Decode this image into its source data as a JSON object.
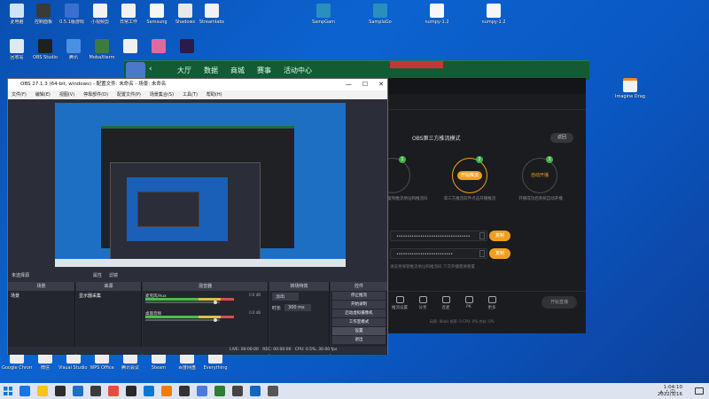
{
  "desktop_icons": [
    {
      "label": "此电脑",
      "color": "#cfe3f7"
    },
    {
      "label": "控制面板",
      "color": "#3a3a3a"
    },
    {
      "label": "0.5.1版游戏",
      "color": "#3a6fd0"
    },
    {
      "label": "小视频剪",
      "color": "#f2f2f2"
    },
    {
      "label": "日常工作",
      "color": "#f2f2f2"
    },
    {
      "label": "Samsung",
      "color": "#f7f7f7"
    },
    {
      "label": "Shadows",
      "color": "#e8e8e8"
    },
    {
      "label": "Streamlabs",
      "color": "#f2f2f2"
    },
    {
      "label": "SampGam",
      "color": "#2a8fbf"
    },
    {
      "label": "SamplaGo",
      "color": "#2a8fbf"
    },
    {
      "label": "numpy-1.2",
      "color": "#f6f6f6"
    },
    {
      "label": "numpy-1.2",
      "color": "#f6f6f6"
    }
  ],
  "desktop_icons_row2": [
    {
      "label": "回收站",
      "color": "#dfe8f2"
    },
    {
      "label": "OBS Studio",
      "color": "#202020"
    },
    {
      "label": "腾讯",
      "color": "#4a90e2"
    },
    {
      "label": "MobaXterm",
      "color": "#3d7a3d"
    },
    {
      "label": "",
      "color": "#f0f0f0"
    },
    {
      "label": "",
      "color": "#e06aa0"
    },
    {
      "label": "",
      "color": "#2b1b48"
    }
  ],
  "bottom_icons": [
    {
      "label": "Google Chrome"
    },
    {
      "label": "微信"
    },
    {
      "label": "Visual Studio Code"
    },
    {
      "label": "WPS Office"
    },
    {
      "label": "腾讯会议"
    },
    {
      "label": "Steam"
    },
    {
      "label": "百度网盘"
    },
    {
      "label": "Everything"
    }
  ],
  "right_file": {
    "label": "Imagine Dragons - ..."
  },
  "green_window": {
    "back": "‹",
    "nav": [
      "大厅",
      "数据",
      "商城",
      "赛事",
      "活动中心"
    ]
  },
  "obs_window": {
    "title": "OBS 27.1.3 (64-bit, windows) - 配置文件: 未命名 - 场景: 未命名",
    "window_controls": [
      "—",
      "☐",
      "✕"
    ],
    "menu": [
      "文件(F)",
      "编辑(E)",
      "视图(V)",
      "停靠部件(D)",
      "配置文件(P)",
      "场景集合(S)",
      "工具(T)",
      "帮助(H)"
    ],
    "no_source": "未选择源",
    "source_buttons": [
      "属性",
      "滤镜"
    ],
    "docks": {
      "scenes": {
        "header": "场景",
        "items": [
          "场景"
        ]
      },
      "sources": {
        "header": "来源",
        "items": [
          "显示器采集"
        ]
      },
      "mixer": {
        "header": "混音器",
        "channels": [
          {
            "name": "麦克风/Aux",
            "db": "0.0 dB"
          },
          {
            "name": "桌面音频",
            "db": "0.0 dB"
          }
        ]
      },
      "transitions": {
        "header": "转场特效",
        "type": "淡出",
        "duration_label": "时长",
        "duration": "300 ms"
      },
      "controls": {
        "header": "控件",
        "buttons": [
          "停止推流",
          "开始录制",
          "启动虚拟摄像机",
          "工作室模式",
          "设置",
          "退出"
        ]
      }
    },
    "status": {
      "live": "LIVE: 00:00:00",
      "rec": "REC: 00:00:00",
      "cpu": "CPU: 0.5%, 30.00 fps"
    }
  },
  "plugin_window": {
    "mode_title": "OBS第三方推流模式",
    "back_button": "返回",
    "steps": [
      {
        "num": "1",
        "label": "",
        "desc": "复制推流地址和推流码"
      },
      {
        "num": "2",
        "label": "开始推流",
        "desc": "第三方推流软件点击开播推流"
      },
      {
        "num": "3",
        "label": "自动开播",
        "desc": "开播成功后系统自动开播"
      }
    ],
    "fields": [
      {
        "mask": "••••••••••••••••••••••••••••••••••",
        "button": "复制"
      },
      {
        "mask": "••••••••••••••••••••••••••",
        "button": "复制"
      }
    ],
    "notice": "请妥善保管推流地址和推流码,下次开播需要重置",
    "tools": [
      "推流设置",
      "分享",
      "连麦",
      "PK",
      "更多"
    ],
    "start_live": "开始直播",
    "stats": "码率: 0kb/s    帧率: 0    CPU: 0%    内存: 0%"
  },
  "taskbar": {
    "app_colors": [
      "#1a73e8",
      "#f5c518",
      "#2d2d2d",
      "#1e6fc8",
      "#3c3c3c",
      "#e74c3c",
      "#2a2a2a",
      "#0078d7",
      "#f57c00",
      "#333333",
      "#4b7bd8",
      "#2e7d32",
      "#444444",
      "#1565c0",
      "#555555"
    ],
    "time": "1:04:10",
    "date": "2022/3/16"
  }
}
